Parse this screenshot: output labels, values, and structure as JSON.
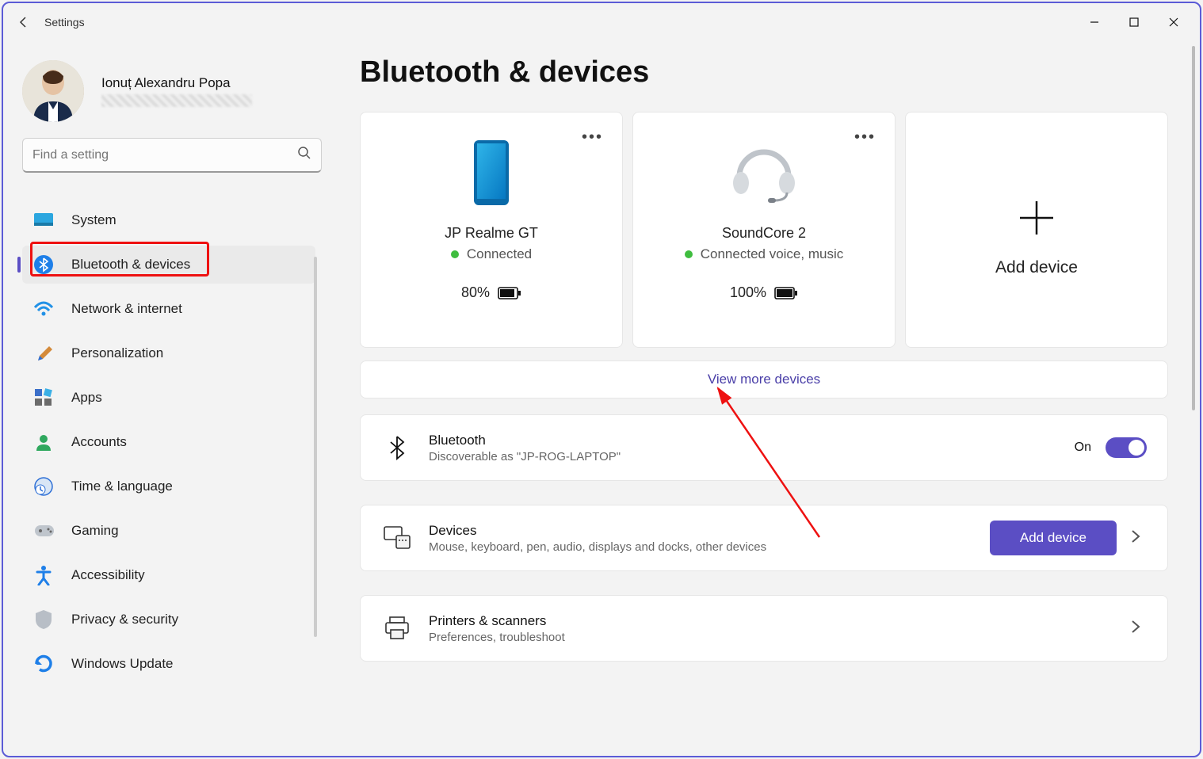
{
  "app": {
    "title": "Settings"
  },
  "user": {
    "name": "Ionuț Alexandru Popa"
  },
  "search": {
    "placeholder": "Find a setting"
  },
  "sidebar": {
    "items": [
      {
        "label": "System",
        "icon": "system"
      },
      {
        "label": "Bluetooth & devices",
        "icon": "bluetooth",
        "active": true
      },
      {
        "label": "Network & internet",
        "icon": "wifi"
      },
      {
        "label": "Personalization",
        "icon": "brush"
      },
      {
        "label": "Apps",
        "icon": "apps"
      },
      {
        "label": "Accounts",
        "icon": "account"
      },
      {
        "label": "Time & language",
        "icon": "clock"
      },
      {
        "label": "Gaming",
        "icon": "gamepad"
      },
      {
        "label": "Accessibility",
        "icon": "accessibility"
      },
      {
        "label": "Privacy & security",
        "icon": "shield"
      },
      {
        "label": "Windows Update",
        "icon": "update"
      }
    ]
  },
  "page": {
    "title": "Bluetooth & devices"
  },
  "devices": [
    {
      "name": "JP Realme GT",
      "status": "Connected",
      "battery": "80%",
      "type": "phone"
    },
    {
      "name": "SoundCore 2",
      "status": "Connected voice, music",
      "battery": "100%",
      "type": "headset"
    }
  ],
  "addDevice": {
    "label": "Add device"
  },
  "viewMore": {
    "label": "View more devices"
  },
  "bluetooth": {
    "title": "Bluetooth",
    "sub": "Discoverable as \"JP-ROG-LAPTOP\"",
    "toggle_label": "On"
  },
  "devicesRow": {
    "title": "Devices",
    "sub": "Mouse, keyboard, pen, audio, displays and docks, other devices",
    "button": "Add device"
  },
  "printers": {
    "title": "Printers & scanners",
    "sub": "Preferences, troubleshoot"
  }
}
